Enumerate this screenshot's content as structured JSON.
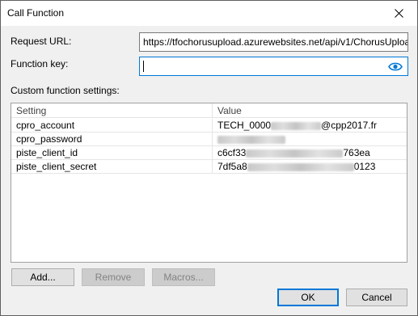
{
  "window": {
    "title": "Call Function"
  },
  "form": {
    "request_url_label": "Request URL:",
    "request_url_value": "https://tfochorusupload.azurewebsites.net/api/v1/ChorusUpload",
    "function_key_label": "Function key:",
    "function_key_value": "",
    "custom_settings_label": "Custom function settings:"
  },
  "grid": {
    "columns": [
      "Setting",
      "Value"
    ],
    "rows": [
      {
        "setting": "cpro_account",
        "value_prefix": "TECH_0000",
        "value_suffix": "@cpp2017.fr"
      },
      {
        "setting": "cpro_password",
        "value_prefix": "",
        "value_suffix": ""
      },
      {
        "setting": "piste_client_id",
        "value_prefix": "c6cf33",
        "value_suffix": "763ea"
      },
      {
        "setting": "piste_client_secret",
        "value_prefix": "7df5a8",
        "value_suffix": "0123"
      }
    ]
  },
  "buttons": {
    "add": "Add...",
    "remove": "Remove",
    "macros": "Macros...",
    "ok": "OK",
    "cancel": "Cancel"
  },
  "icons": {
    "close": "close-icon",
    "eye": "eye-icon"
  },
  "colors": {
    "accent": "#0078d7",
    "dialog_bg": "#f0f0f0"
  }
}
